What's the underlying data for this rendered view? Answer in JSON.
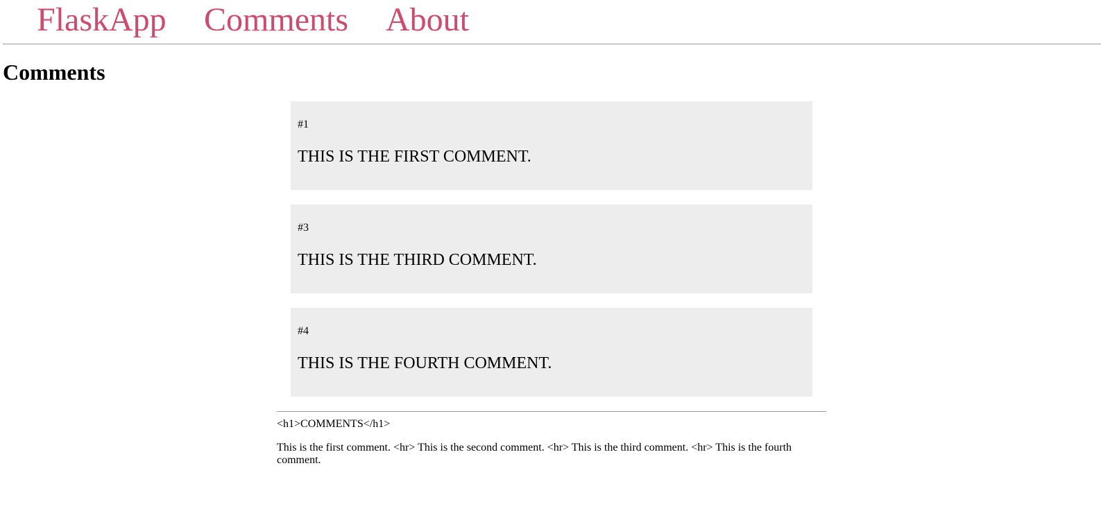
{
  "nav": {
    "link_color": "#d14a6c",
    "brand": "FlaskApp",
    "links": [
      "Comments",
      "About"
    ]
  },
  "page_title": "Comments",
  "comments": [
    {
      "number": "#1",
      "text": "THIS IS THE FIRST COMMENT."
    },
    {
      "number": "#3",
      "text": "THIS IS THE THIRD COMMENT."
    },
    {
      "number": "#4",
      "text": "THIS IS THE FOURTH COMMENT."
    }
  ],
  "raw_output": {
    "heading": "<h1>COMMENTS</h1>",
    "body": "This is the first comment. <hr> This is the second comment. <hr> This is the third comment. <hr> This is the fourth comment."
  },
  "colors": {
    "card_background": "#ededed",
    "rule": "#9a9a9a"
  }
}
